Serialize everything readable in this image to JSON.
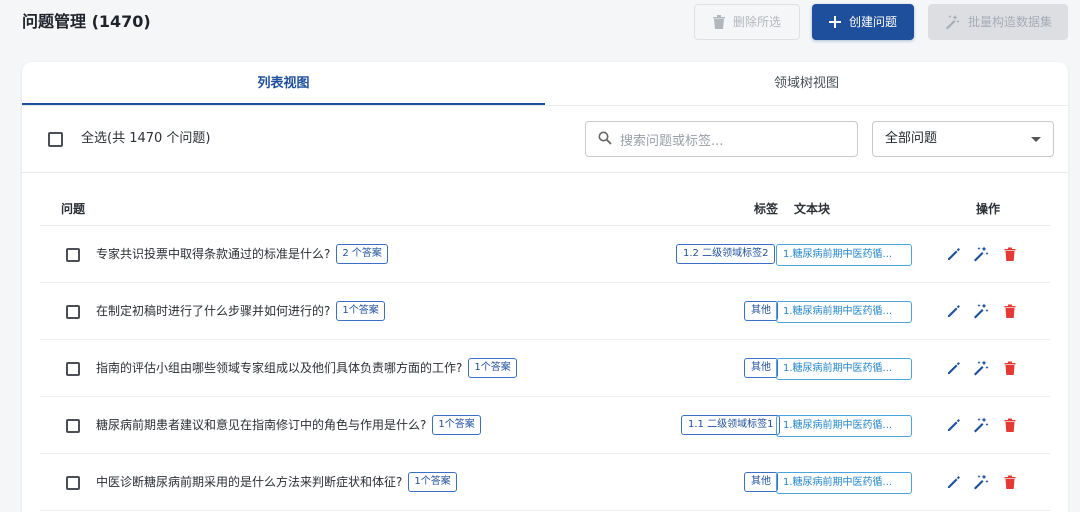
{
  "header": {
    "title": "问题管理 (1470)",
    "delete_selected_label": "删除所选",
    "create_label": "创建问题",
    "batch_label": "批量构造数据集"
  },
  "tabs": [
    {
      "label": "列表视图",
      "active": true
    },
    {
      "label": "领域树视图",
      "active": false
    }
  ],
  "toolbar": {
    "select_all_label": "全选(共 1470 个问题)",
    "search_placeholder": "搜索问题或标签...",
    "filter_value": "全部问题"
  },
  "table": {
    "columns": {
      "question": "问题",
      "tags": "标签",
      "chunk": "文本块",
      "actions": "操作"
    },
    "rows": [
      {
        "question": "专家共识投票中取得条款通过的标准是什么?",
        "answers": "2 个答案",
        "tag": "1.2 二级领域标签2",
        "chunk": "1.糖尿病前期中医药循..."
      },
      {
        "question": "在制定初稿时进行了什么步骤并如何进行的?",
        "answers": "1个答案",
        "tag": "其他",
        "chunk": "1.糖尿病前期中医药循..."
      },
      {
        "question": "指南的评估小组由哪些领域专家组成以及他们具体负责哪方面的工作?",
        "answers": "1个答案",
        "tag": "其他",
        "chunk": "1.糖尿病前期中医药循..."
      },
      {
        "question": "糖尿病前期患者建议和意见在指南修订中的角色与作用是什么?",
        "answers": "1个答案",
        "tag": "1.1 二级领域标签1",
        "chunk": "1.糖尿病前期中医药循..."
      },
      {
        "question": "中医诊断糖尿病前期采用的是什么方法来判断症状和体征?",
        "answers": "1个答案",
        "tag": "其他",
        "chunk": "1.糖尿病前期中医药循..."
      }
    ]
  },
  "colors": {
    "primary": "#1e4f9c",
    "chunk_blue": "#2386c8",
    "delete_red": "#e53935",
    "background": "#f5f6f8"
  },
  "icons": {
    "delete_selected": "trash-icon",
    "create": "plus-icon",
    "batch": "magic-wand-icon",
    "search": "search-icon",
    "row_edit": "pencil-icon",
    "row_generate": "magic-wand-icon",
    "row_delete": "trash-icon"
  }
}
